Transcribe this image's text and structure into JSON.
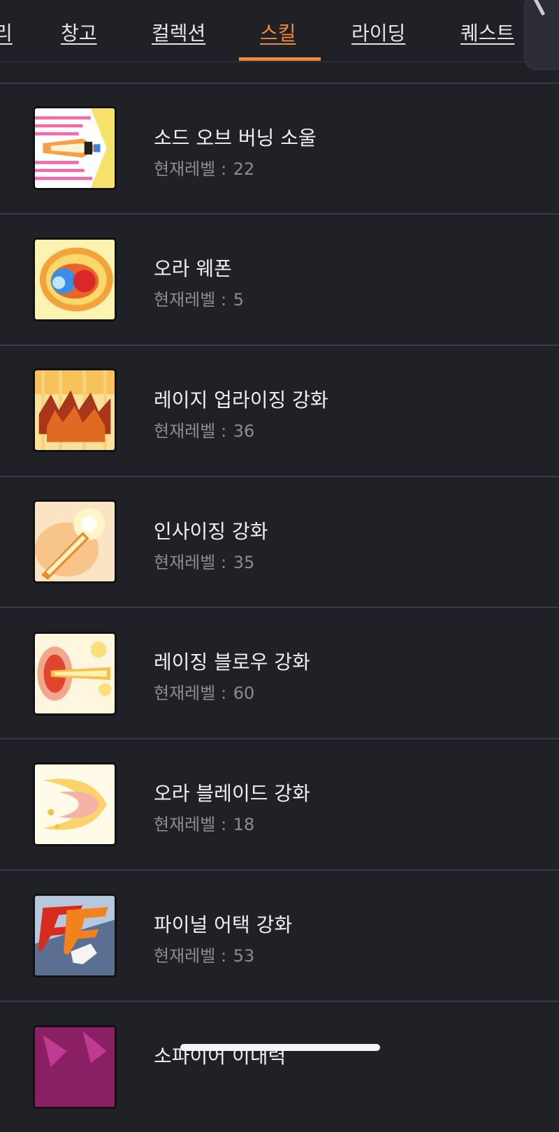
{
  "tabs": [
    {
      "label": "리"
    },
    {
      "label": "창고"
    },
    {
      "label": "컬렉션"
    },
    {
      "label": "스킬",
      "active": true
    },
    {
      "label": "라이딩"
    },
    {
      "label": "퀘스트"
    }
  ],
  "level_prefix": "현재레벨 :",
  "skills": [
    {
      "name": "소드 오브 버닝 소울",
      "level": "22",
      "icon": "sword-of-burning-soul-icon"
    },
    {
      "name": "오라 웨폰",
      "level": "5",
      "icon": "aura-weapon-icon"
    },
    {
      "name": "레이지 업라이징 강화",
      "level": "36",
      "icon": "rage-uprising-icon"
    },
    {
      "name": "인사이징 강화",
      "level": "35",
      "icon": "incising-icon"
    },
    {
      "name": "레이징 블로우 강화",
      "level": "60",
      "icon": "raging-blow-icon"
    },
    {
      "name": "오라 블레이드 강화",
      "level": "18",
      "icon": "aura-blade-icon"
    },
    {
      "name": "파이널 어택 강화",
      "level": "53",
      "icon": "final-attack-icon"
    },
    {
      "name": "소파이어 이내력",
      "level": "",
      "icon": "partial-skill-icon"
    }
  ],
  "colors": {
    "background": "#202127",
    "accent": "#f08a3c",
    "divider": "#3a3b43",
    "level_text": "#8b8c92"
  }
}
